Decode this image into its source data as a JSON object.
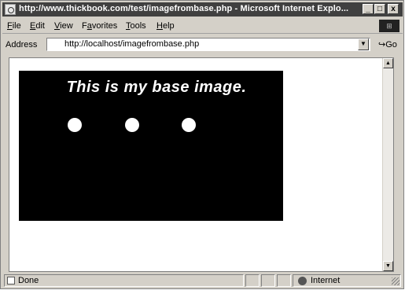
{
  "window": {
    "title": "http://www.thickbook.com/test/imagefrombase.php - Microsoft Internet Explo...",
    "controls": {
      "minimize": "_",
      "maximize": "□",
      "close": "x"
    }
  },
  "menu": {
    "items": [
      {
        "label": "File",
        "u": "F",
        "rest": "ile"
      },
      {
        "label": "Edit",
        "u": "E",
        "rest": "dit"
      },
      {
        "label": "View",
        "u": "V",
        "rest": "iew"
      },
      {
        "label": "Favorites",
        "u": "a",
        "pre": "F",
        "rest": "vorites"
      },
      {
        "label": "Tools",
        "u": "T",
        "rest": "ools"
      },
      {
        "label": "Help",
        "u": "H",
        "rest": "elp"
      }
    ]
  },
  "address": {
    "label": "Address",
    "url": "http://localhost/imagefrombase.php",
    "go_label": "Go"
  },
  "content": {
    "image_text": "This is my base image.",
    "dot_count": 3
  },
  "status": {
    "text": "Done",
    "zone": "Internet"
  },
  "icons": [
    "ie-page-icon",
    "windows-throbber-icon",
    "dropdown-arrow-icon",
    "go-arrow-icon",
    "scroll-up-arrow-icon",
    "scroll-down-arrow-icon",
    "page-done-icon",
    "internet-zone-icon"
  ]
}
